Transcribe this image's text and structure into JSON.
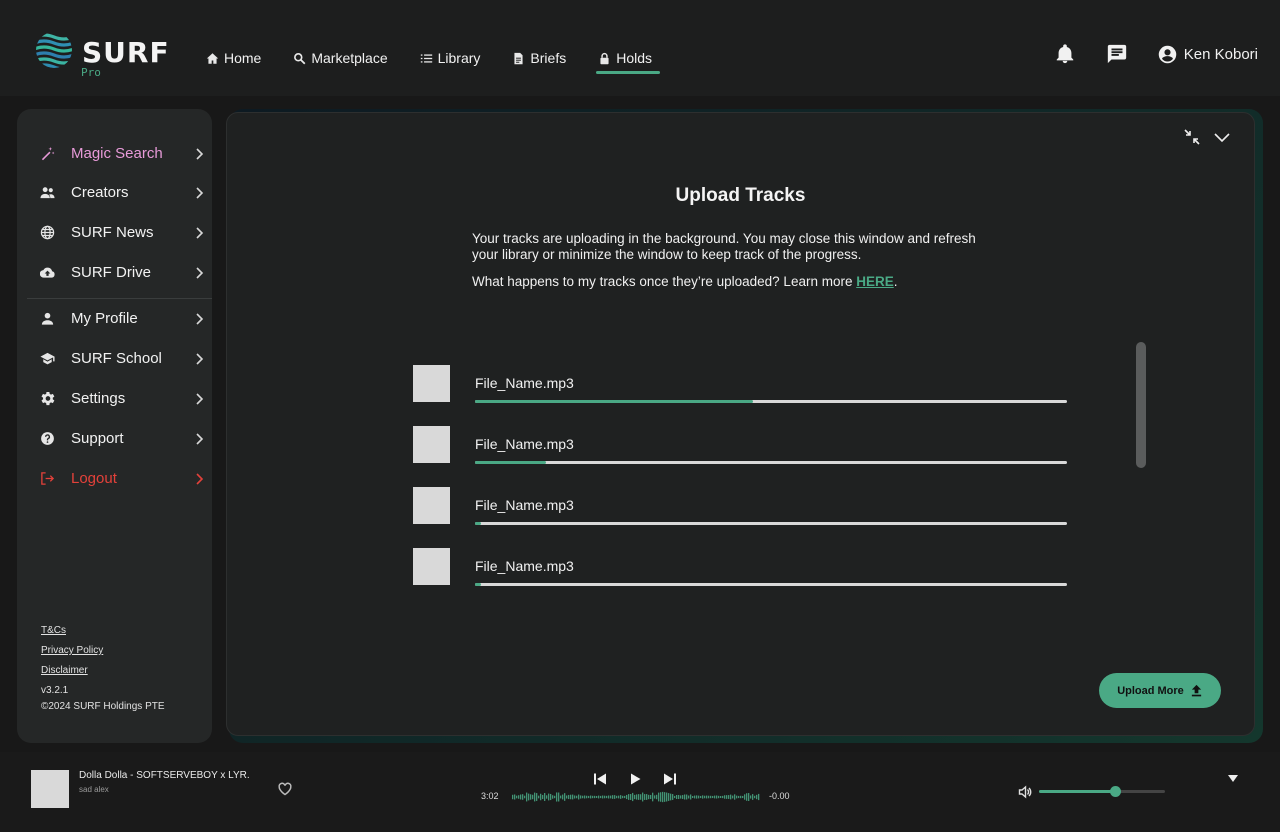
{
  "header": {
    "logo_text": "SURF",
    "logo_sub": "Pro",
    "nav": [
      {
        "label": "Home",
        "icon": "home-icon"
      },
      {
        "label": "Marketplace",
        "icon": "search-icon"
      },
      {
        "label": "Library",
        "icon": "list-icon"
      },
      {
        "label": "Briefs",
        "icon": "document-icon"
      },
      {
        "label": "Holds",
        "icon": "lock-icon",
        "active": true
      }
    ],
    "user_name": "Ken Kobori"
  },
  "sidebar": {
    "items": [
      {
        "label": "Magic Search",
        "icon": "magic-wand-icon"
      },
      {
        "label": "Creators",
        "icon": "people-icon"
      },
      {
        "label": "SURF News",
        "icon": "globe-icon"
      },
      {
        "label": "SURF Drive",
        "icon": "cloud-upload-icon"
      },
      {
        "label": "My Profile",
        "icon": "person-icon"
      },
      {
        "label": "SURF School",
        "icon": "school-icon"
      },
      {
        "label": "Settings",
        "icon": "gear-icon"
      },
      {
        "label": "Support",
        "icon": "help-icon"
      },
      {
        "label": "Logout",
        "icon": "logout-icon"
      }
    ],
    "footer": {
      "tcs": "T&Cs",
      "privacy": "Privacy Policy",
      "disclaimer": "Disclaimer",
      "version": "v3.2.1",
      "copyright": "©2024 SURF Holdings PTE"
    }
  },
  "upload": {
    "title": "Upload Tracks",
    "description": "Your tracks are uploading in the background. You may close this window and refresh your library or minimize the window to keep track of the progress.",
    "learn_prefix": "What happens to my tracks once they’re uploaded? Learn more ",
    "learn_link": "HERE",
    "learn_suffix": ".",
    "tracks": [
      {
        "name": "File_Name.mp3",
        "progress": 0.47
      },
      {
        "name": "File_Name.mp3",
        "progress": 0.12
      },
      {
        "name": "File_Name.mp3",
        "progress": 0.01
      },
      {
        "name": "File_Name.mp3",
        "progress": 0.01
      }
    ],
    "upload_more_label": "Upload More"
  },
  "player": {
    "title": "Dolla Dolla - SOFTSERVEBOY x LYR...",
    "artist": "sad alex",
    "elapsed": "3:02",
    "remaining": "-0.00",
    "volume": 0.6
  },
  "colors": {
    "accent": "#4aa985",
    "magic": "#e79ad8",
    "danger": "#e3413a"
  }
}
